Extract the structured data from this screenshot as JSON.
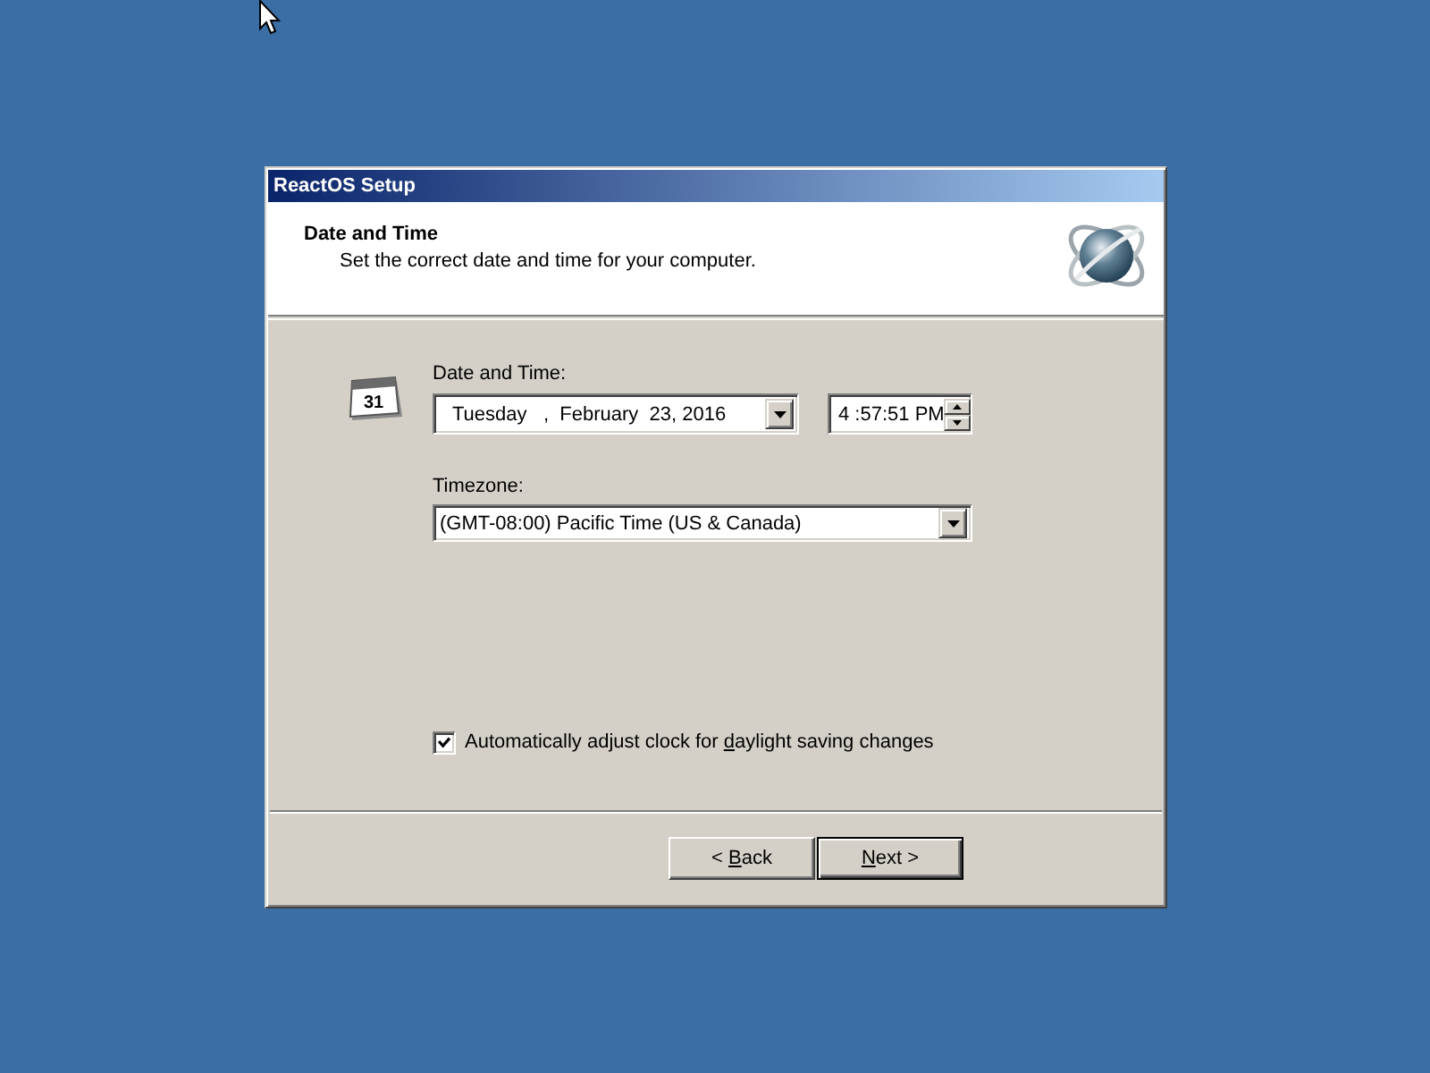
{
  "window": {
    "title": "ReactOS Setup"
  },
  "header": {
    "title": "Date and Time",
    "subtitle": "Set the correct date and time for your computer."
  },
  "date_time": {
    "label": "Date and Time:",
    "icon_text": "31",
    "date": {
      "value": "Tuesday   ,  February  23, 2016"
    },
    "time": {
      "value": "4 :57:51 PM"
    }
  },
  "timezone": {
    "label": "Timezone:",
    "value": "(GMT-08:00) Pacific Time (US & Canada)"
  },
  "daylight_checkbox": {
    "label": {
      "before": "Automatically adjust clock for ",
      "access_key": "d",
      "after": "aylight saving changes"
    },
    "checked": true
  },
  "buttons": [
    {
      "label": {
        "before": "< ",
        "access_key": "B",
        "after": "ack"
      },
      "default": false
    },
    {
      "label": {
        "access_key": "N",
        "after": "ext >"
      },
      "default": true
    }
  ]
}
